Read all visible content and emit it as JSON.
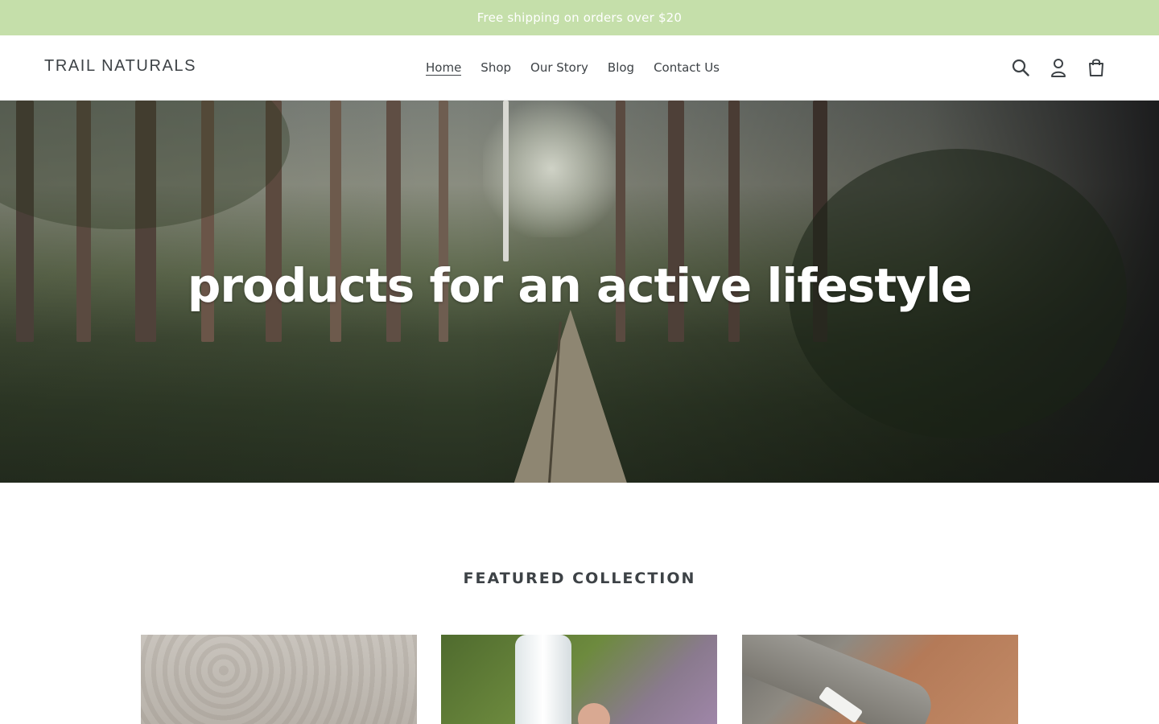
{
  "announcement": {
    "text": "Free shipping on orders over $20"
  },
  "header": {
    "logo": "TRAIL NATURALS",
    "nav": [
      {
        "label": "Home",
        "active": true
      },
      {
        "label": "Shop",
        "active": false
      },
      {
        "label": "Our Story",
        "active": false
      },
      {
        "label": "Blog",
        "active": false
      },
      {
        "label": "Contact Us",
        "active": false
      }
    ],
    "icons": [
      "search-icon",
      "account-icon",
      "cart-icon"
    ]
  },
  "hero": {
    "title": "products for an active lifestyle"
  },
  "featured": {
    "title": "FEATURED COLLECTION"
  },
  "colors": {
    "announcement_bg": "#c5dfaa",
    "text": "#3d4246",
    "white": "#ffffff"
  }
}
